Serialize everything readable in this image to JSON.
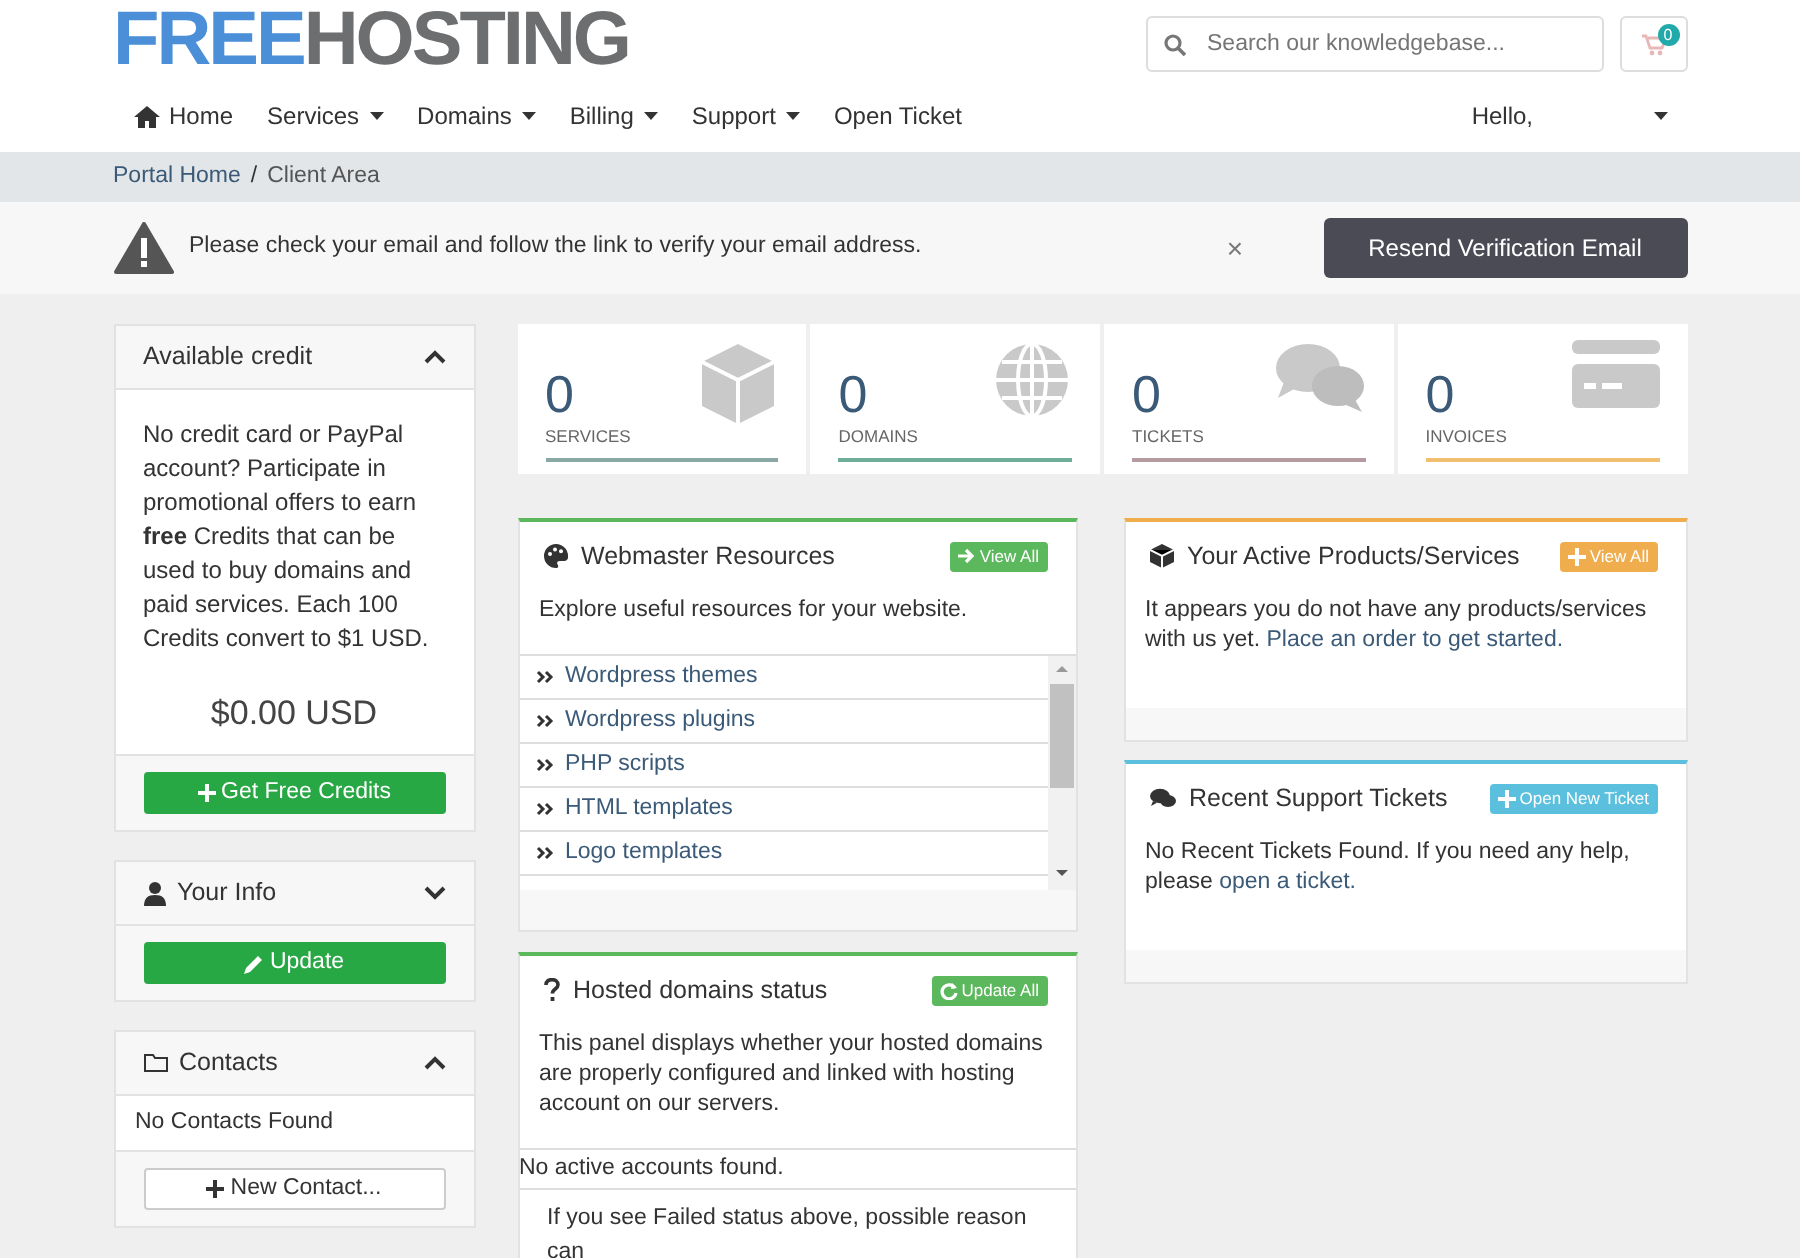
{
  "header": {
    "logo": {
      "part_1": "FREE",
      "part_2": "HOSTING"
    },
    "search": {
      "placeholder": "Search our knowledgebase..."
    },
    "cart_count": "0"
  },
  "nav": {
    "items": [
      {
        "label": "Home",
        "kind": "home"
      },
      {
        "label": "Services",
        "kind": "dropdown"
      },
      {
        "label": "Domains",
        "kind": "dropdown"
      },
      {
        "label": "Billing",
        "kind": "dropdown"
      },
      {
        "label": "Support",
        "kind": "dropdown"
      },
      {
        "label": "Open Ticket",
        "kind": "link"
      }
    ],
    "greeting": "Hello,"
  },
  "breadcrumb_separator": "/",
  "breadcrumb": [
    {
      "label": "Portal Home",
      "selected": false
    },
    {
      "label": "Client Area",
      "selected": true
    }
  ],
  "alert": {
    "message": "Please check your email and follow the link to verify your email address.",
    "close": "×",
    "button": "Resend Verification Email"
  },
  "sidebar": {
    "credit": {
      "title": "Available credit",
      "expanded": true,
      "text": "No credit card or PayPal account? Participate in promotional offers to earn **free** Credits that can be used to buy domains and paid services. Each 100 Credits convert to $1 USD.",
      "amount": "$0.00 USD",
      "button": "Get Free Credits"
    },
    "info": {
      "title": "Your Info",
      "expanded": false,
      "button": "Update"
    },
    "contacts": {
      "title": "Contacts",
      "expanded": true,
      "empty": "No Contacts Found",
      "button": "New Contact..."
    }
  },
  "stats": [
    {
      "count": "0",
      "label": "SERVICES",
      "kind": "services",
      "color": "#8aa9a6"
    },
    {
      "count": "0",
      "label": "DOMAINS",
      "kind": "domains",
      "color": "#6fae98"
    },
    {
      "count": "0",
      "label": "TICKETS",
      "kind": "tickets",
      "color": "#b59ba0"
    },
    {
      "count": "0",
      "label": "INVOICES",
      "kind": "invoices",
      "color": "#f0c070"
    }
  ],
  "middle_column": [
    {
      "kind": "webmaster",
      "title": "Webmaster Resources",
      "color": "#5cb85c",
      "button": "View All",
      "text": "Explore useful resources for your website.",
      "items": [
        "Wordpress themes",
        "Wordpress plugins",
        "PHP scripts",
        "HTML templates",
        "Logo templates"
      ]
    },
    {
      "kind": "hosted",
      "title": "Hosted domains status",
      "color": "#5cb85c",
      "button": "Update All",
      "text": "This panel displays whether your hosted domains are properly configured and linked with hosting account on our servers.",
      "empty": "No active accounts found.",
      "note": "If you see Failed status above, possible reason can"
    }
  ],
  "right_column": [
    {
      "kind": "products",
      "title": "Your Active Products/Services",
      "color": "#f0ad4e",
      "button": "View All",
      "text": "It appears you do not have any products/services with us yet.",
      "link": "Place an order to get started."
    },
    {
      "kind": "tickets",
      "title": "Recent Support Tickets",
      "color": "#5bc0de",
      "button": "Open New Ticket",
      "text": "No Recent Tickets Found. If you need any help, please",
      "link": "open a ticket."
    }
  ]
}
